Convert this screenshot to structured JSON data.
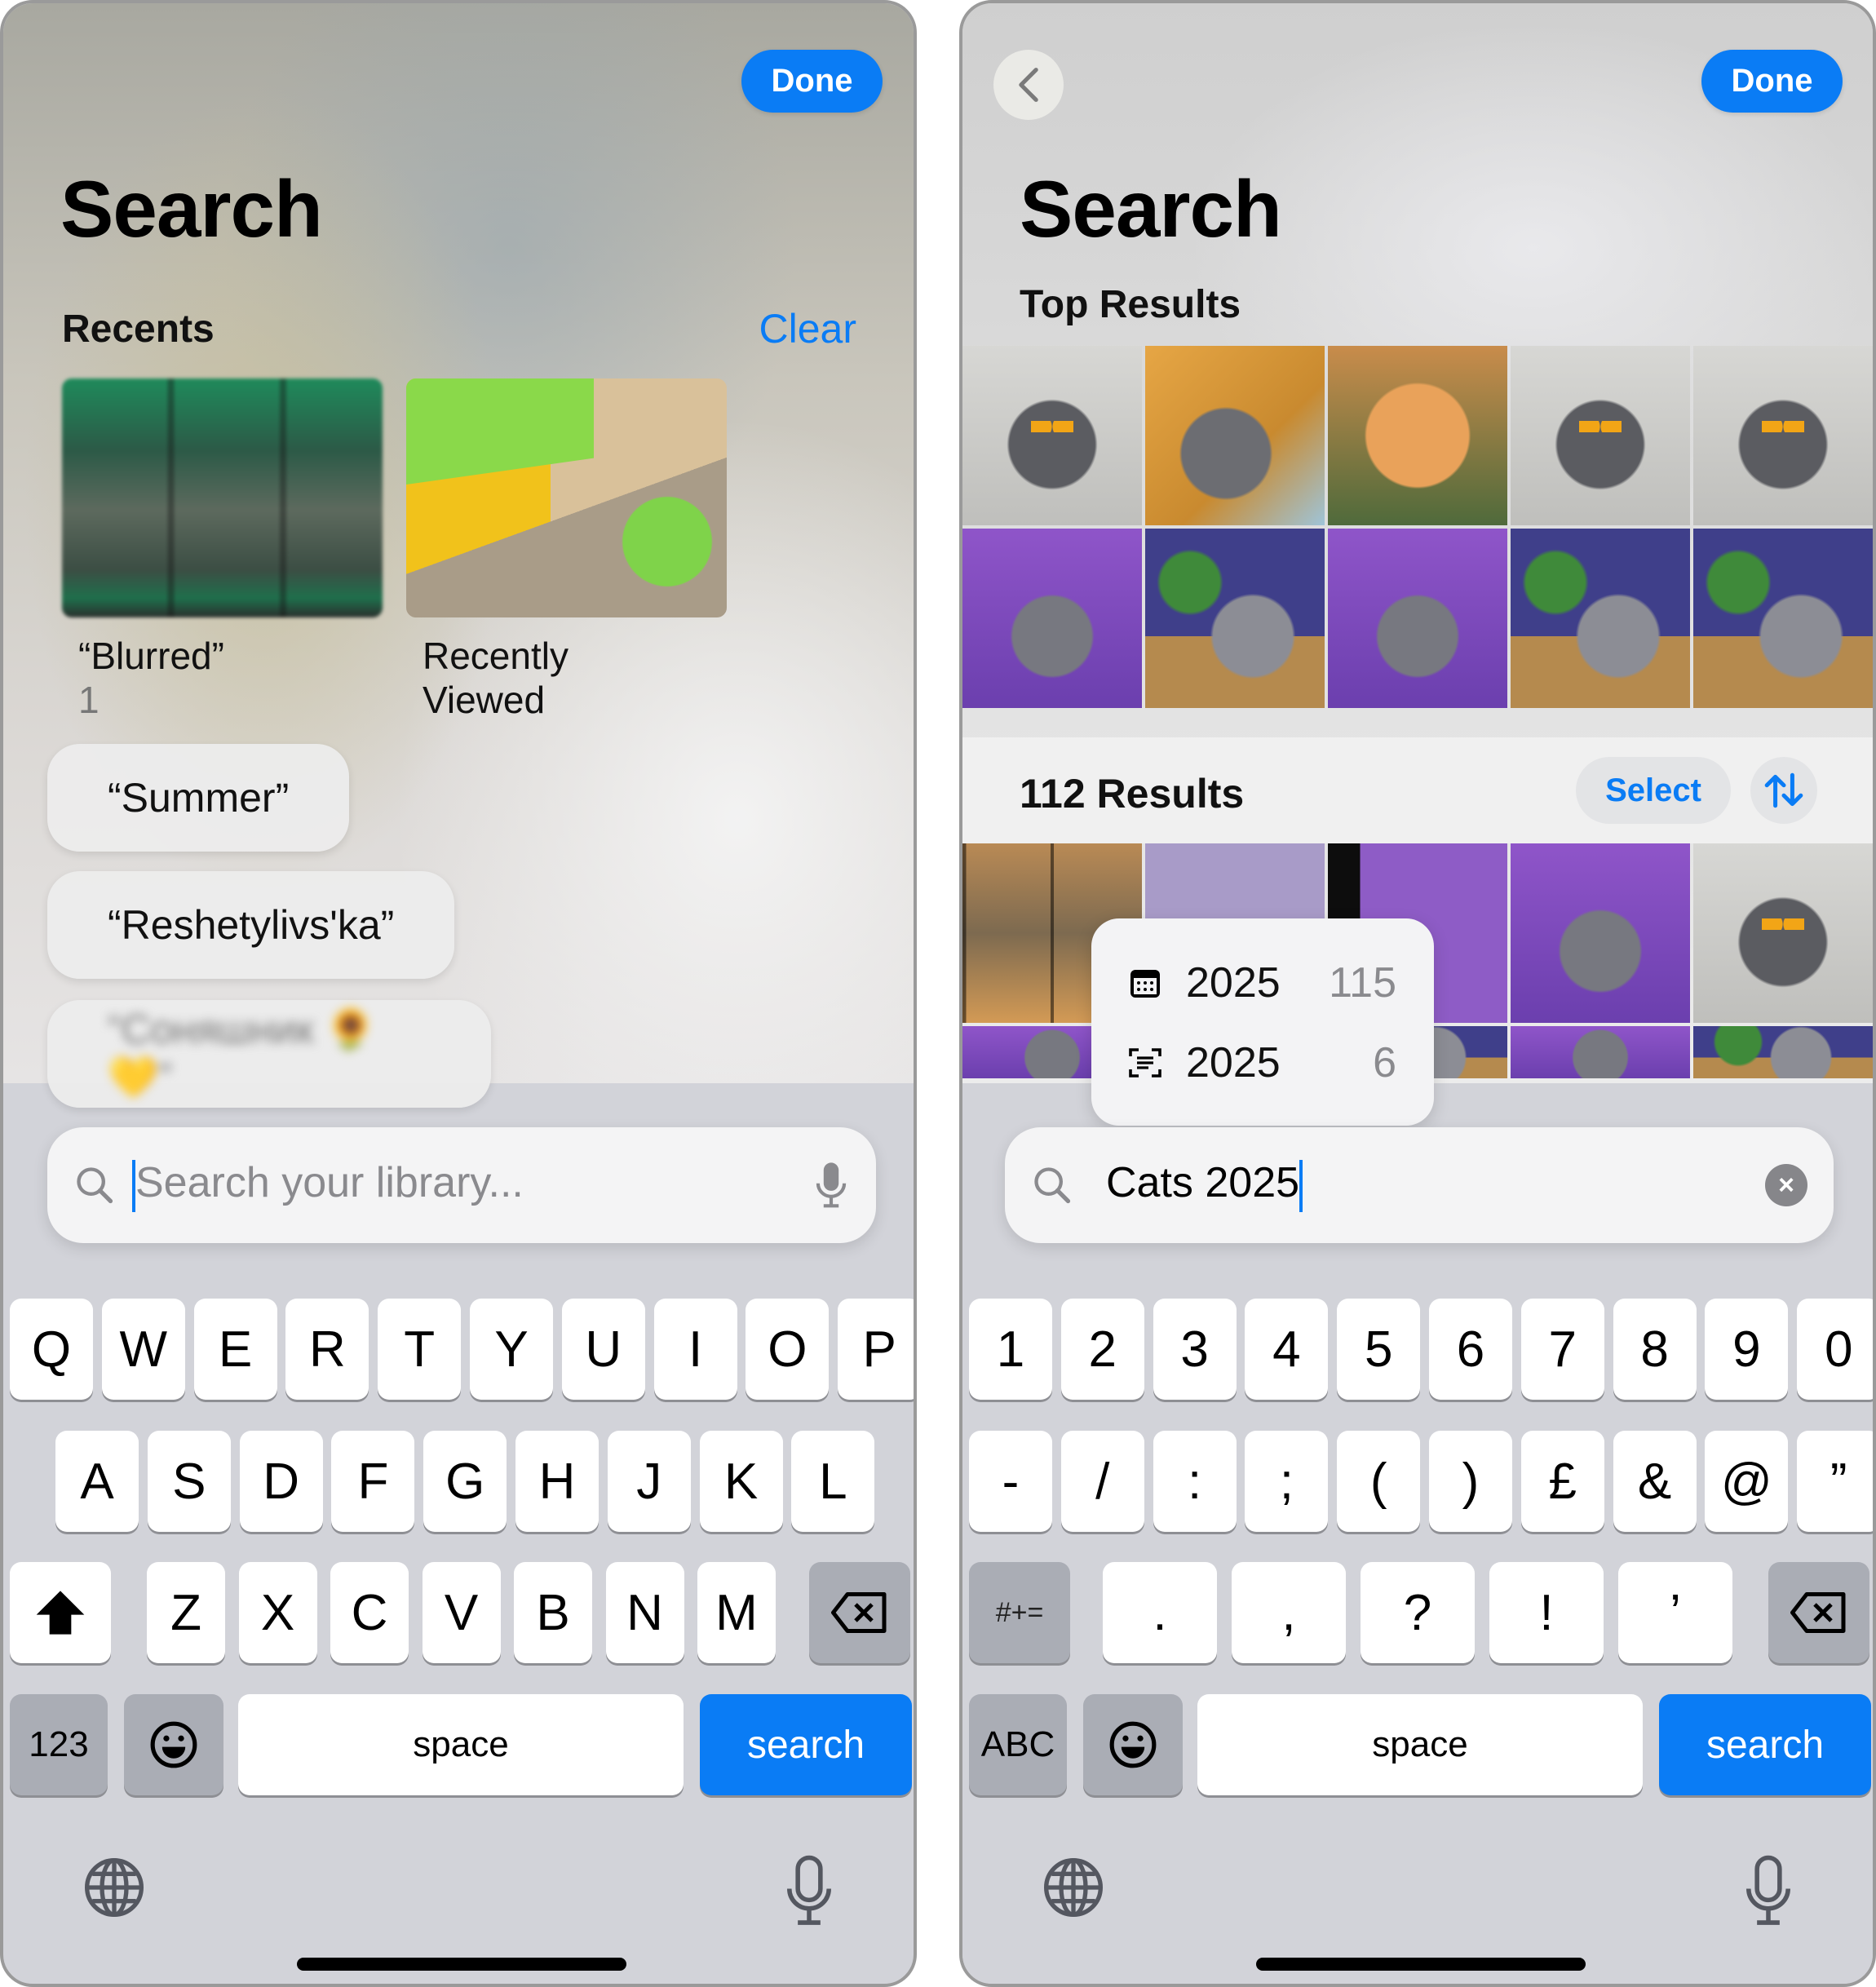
{
  "left": {
    "done_label": "Done",
    "title": "Search",
    "recents": {
      "heading": "Recents",
      "clear_label": "Clear",
      "cards": [
        {
          "title": "“Blurred”",
          "count": "1"
        },
        {
          "title": "Recently Viewed",
          "count": ""
        }
      ],
      "pills": [
        "“Summer”",
        "“Reshetylivs'ka”",
        "“Cоняшник 🌻💛”"
      ]
    },
    "search": {
      "placeholder": "Search your library...",
      "value": ""
    },
    "keyboard": {
      "row1": [
        "Q",
        "W",
        "E",
        "R",
        "T",
        "Y",
        "U",
        "I",
        "O",
        "P"
      ],
      "row2": [
        "A",
        "S",
        "D",
        "F",
        "G",
        "H",
        "J",
        "K",
        "L"
      ],
      "row3": [
        "Z",
        "X",
        "C",
        "V",
        "B",
        "N",
        "M"
      ],
      "mode_label": "123",
      "space_label": "space",
      "action_label": "search"
    }
  },
  "right": {
    "done_label": "Done",
    "title": "Search",
    "top_results_heading": "Top Results",
    "results_count": "112 Results",
    "select_label": "Select",
    "suggestions": [
      {
        "icon": "calendar-icon",
        "label": "2025",
        "count": "115"
      },
      {
        "icon": "text-scan-icon",
        "label": "2025",
        "count": "6"
      }
    ],
    "search": {
      "value": "Cats 2025"
    },
    "keyboard": {
      "row1": [
        "1",
        "2",
        "3",
        "4",
        "5",
        "6",
        "7",
        "8",
        "9",
        "0"
      ],
      "row2": [
        "-",
        "/",
        ":",
        ";",
        "(",
        ")",
        "£",
        "&",
        "@",
        "”"
      ],
      "row3": [
        ".",
        ",",
        "?",
        "!",
        "’"
      ],
      "symbols_label": "#+=",
      "mode_label": "ABC",
      "space_label": "space",
      "action_label": "search"
    }
  }
}
